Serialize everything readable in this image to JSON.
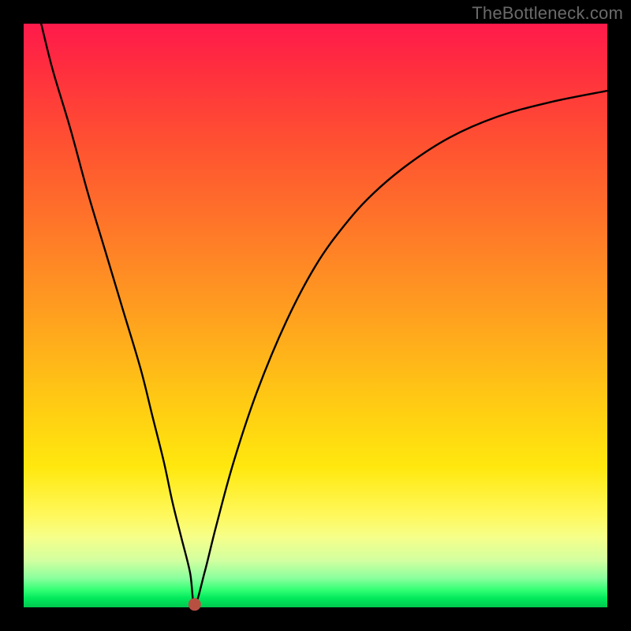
{
  "watermark": "TheBottleneck.com",
  "chart_data": {
    "type": "line",
    "title": "",
    "xlabel": "",
    "ylabel": "",
    "xlim": [
      0,
      100
    ],
    "ylim": [
      0,
      100
    ],
    "grid": false,
    "legend": false,
    "series": [
      {
        "name": "bottleneck-curve",
        "x": [
          3,
          5,
          8,
          11,
          14,
          17,
          20,
          22,
          24,
          25.5,
          27,
          28.5,
          29.3,
          31,
          33,
          36,
          40,
          45,
          50,
          55,
          60,
          66,
          73,
          81,
          90,
          100
        ],
        "values": [
          100,
          92,
          82,
          71,
          61,
          51,
          41,
          33,
          25,
          18,
          12,
          6,
          0.5,
          6,
          14,
          25,
          37,
          49,
          58.5,
          65.5,
          71,
          76,
          80.5,
          84,
          86.5,
          88.5
        ]
      }
    ],
    "marker": {
      "x": 29.3,
      "y": 0.5
    },
    "background_gradient_stops": [
      {
        "pos": 0.0,
        "color": "#ff1a4b"
      },
      {
        "pos": 0.5,
        "color": "#ffa520"
      },
      {
        "pos": 0.8,
        "color": "#fff02a"
      },
      {
        "pos": 0.95,
        "color": "#8aff9d"
      },
      {
        "pos": 1.0,
        "color": "#00c94f"
      }
    ]
  }
}
